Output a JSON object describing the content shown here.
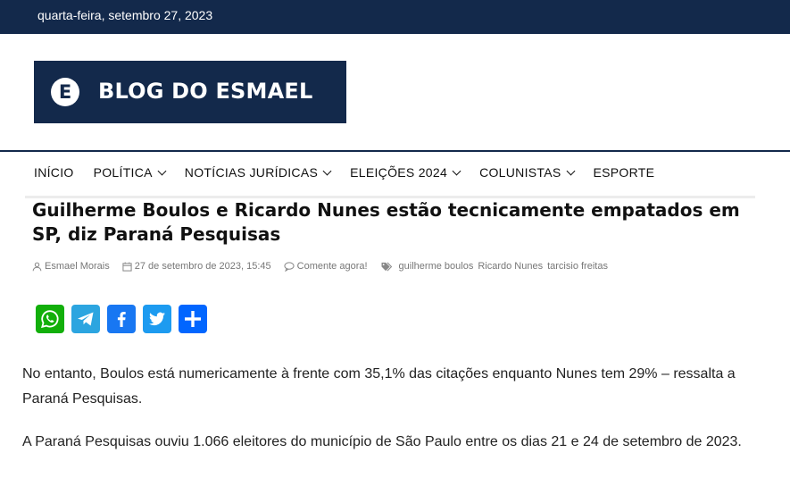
{
  "topbar": {
    "date": "quarta-feira, setembro 27, 2023"
  },
  "logo": {
    "letter": "E",
    "text": "BLOG DO ESMAEL"
  },
  "nav": {
    "items": [
      {
        "label": "INÍCIO",
        "dropdown": false
      },
      {
        "label": "POLÍTICA",
        "dropdown": true
      },
      {
        "label": "NOTÍCIAS JURÍDICAS",
        "dropdown": true
      },
      {
        "label": "ELEIÇÕES 2024",
        "dropdown": true
      },
      {
        "label": "COLUNISTAS",
        "dropdown": true
      },
      {
        "label": "ESPORTE",
        "dropdown": false
      }
    ]
  },
  "article": {
    "title": "Guilherme Boulos e Ricardo Nunes estão tecnicamente empatados em SP, diz Paraná Pesquisas",
    "meta": {
      "author": "Esmael Morais",
      "date": "27 de setembro de 2023, 15:45",
      "comments": "Comente agora!",
      "tags": [
        "guilherme boulos",
        "Ricardo Nunes",
        "tarcisio freitas"
      ]
    },
    "paragraphs": [
      "No entanto, Boulos está numericamente à frente com 35,1% das citações enquanto Nunes tem 29% – ressalta a Paraná Pesquisas.",
      "A Paraná Pesquisas ouviu 1.066 eleitores do município de São Paulo entre os dias 21 e 24 de setembro de 2023."
    ]
  },
  "share": {
    "buttons": [
      {
        "icon": "whatsapp-icon",
        "color": "#12af0a"
      },
      {
        "icon": "telegram-icon",
        "color": "#2ca5e0"
      },
      {
        "icon": "facebook-icon",
        "color": "#1877f2"
      },
      {
        "icon": "twitter-icon",
        "color": "#1d9bf0"
      },
      {
        "icon": "share-icon",
        "color": "#0166ff"
      }
    ]
  },
  "colors": {
    "brand_navy": "#13294b"
  }
}
